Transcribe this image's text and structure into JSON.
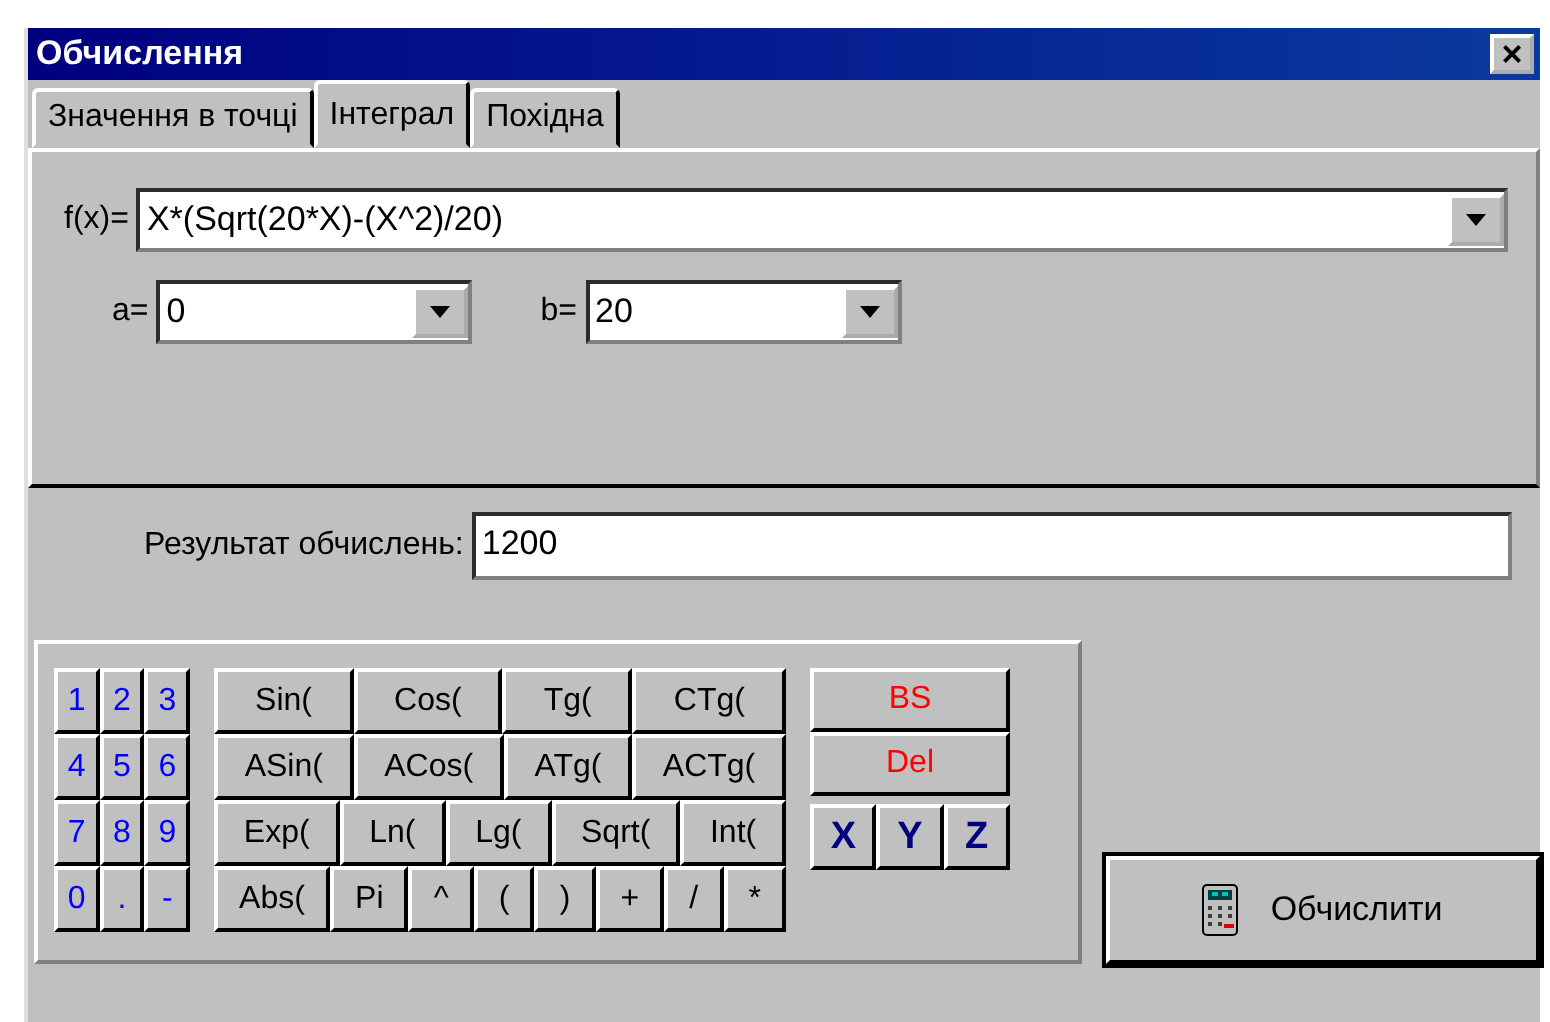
{
  "window": {
    "title": "Обчислення",
    "close": "×"
  },
  "tabs": [
    {
      "label": "Значення в точці",
      "selected": false
    },
    {
      "label": "Інтеграл",
      "selected": true
    },
    {
      "label": "Похідна",
      "selected": false
    }
  ],
  "function_field": {
    "label": "f(x)=",
    "value": "X*(Sqrt(20*X)-(X^2)/20)"
  },
  "limits": [
    {
      "label": "a=",
      "value": "0"
    },
    {
      "label": "b=",
      "value": "20"
    }
  ],
  "result": {
    "label": "Результат обчислень:",
    "value": "1200"
  },
  "digit_keys": [
    [
      "1",
      "2",
      "3"
    ],
    [
      "4",
      "5",
      "6"
    ],
    [
      "7",
      "8",
      "9"
    ],
    [
      "0",
      ".",
      "-"
    ]
  ],
  "function_keys": [
    [
      "Sin(",
      "Cos(",
      "Tg(",
      "CTg("
    ],
    [
      "ASin(",
      "ACos(",
      "ATg(",
      "ACTg("
    ],
    [
      "Exp(",
      "Ln(",
      "Lg(",
      "Sqrt(",
      "Int("
    ],
    [
      "Abs(",
      "Pi",
      "^",
      "(",
      ")",
      "+",
      "/",
      "*"
    ]
  ],
  "edit_keys": [
    "BS",
    "Del"
  ],
  "variable_keys": [
    "X",
    "Y",
    "Z"
  ],
  "calculate_button": {
    "label": "Обчислити"
  }
}
